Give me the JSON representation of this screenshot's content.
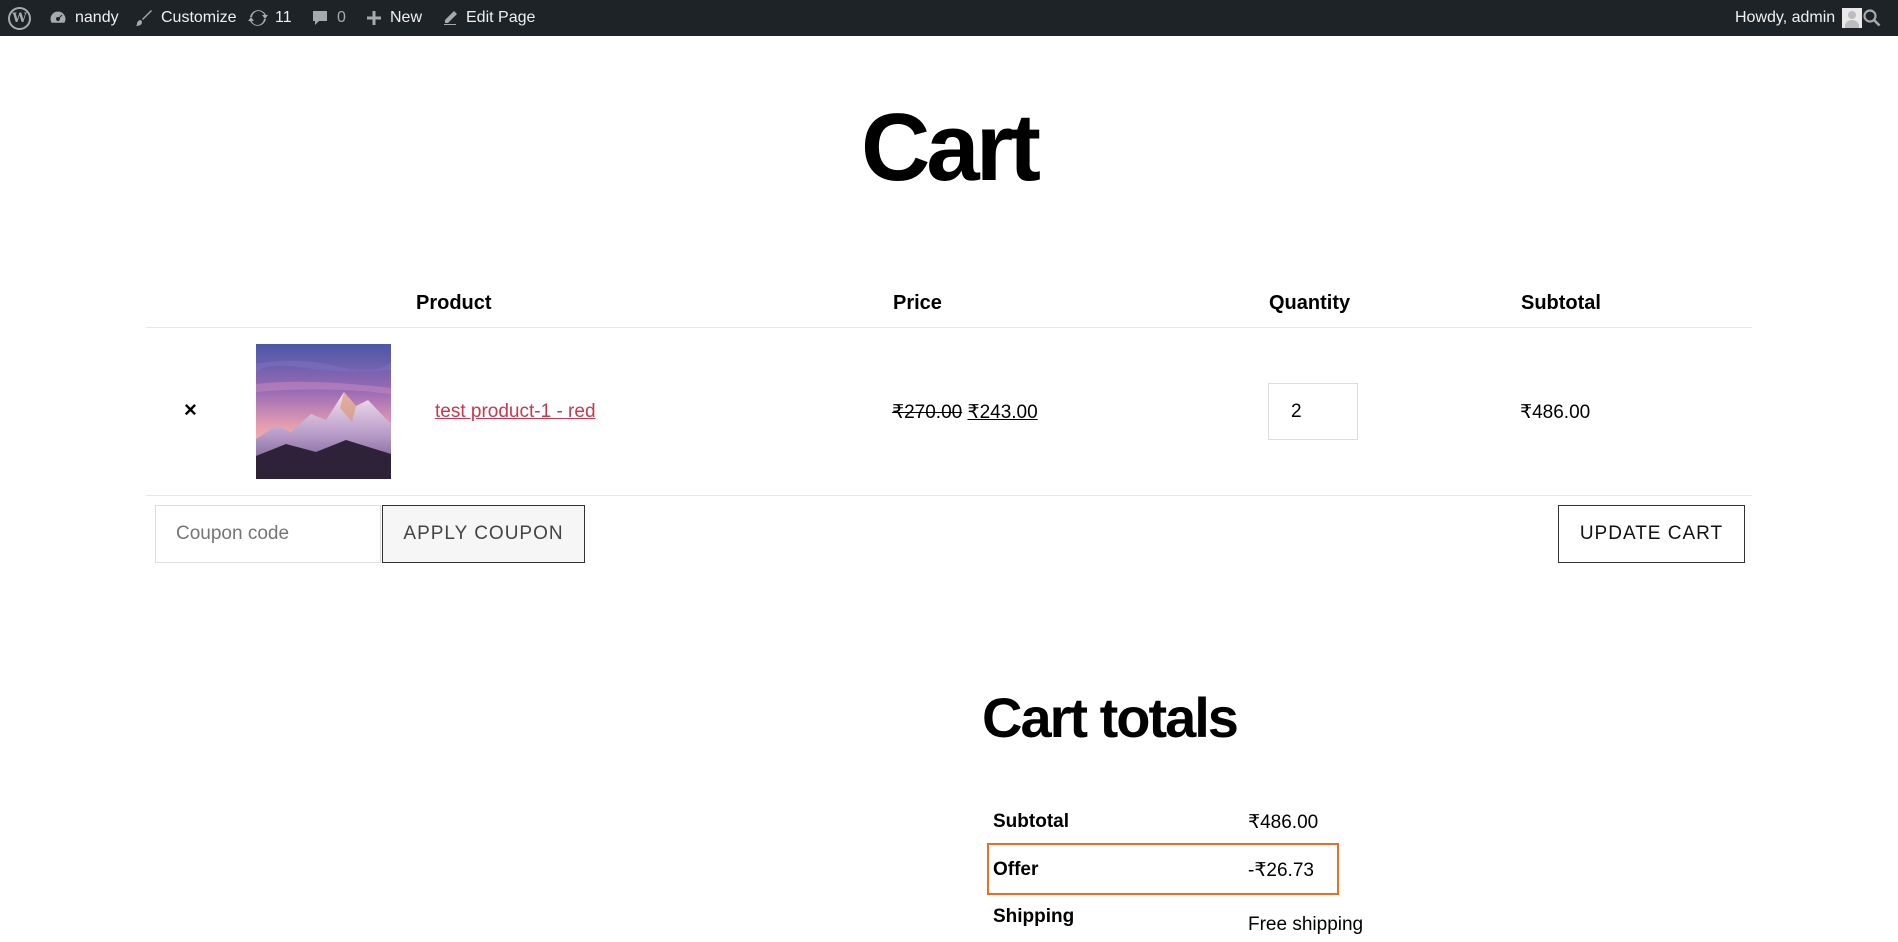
{
  "admin_bar": {
    "site_name": "nandy",
    "customize": "Customize",
    "updates_count": "11",
    "comments_count": "0",
    "new": "New",
    "edit_page": "Edit Page",
    "howdy": "Howdy, admin"
  },
  "page": {
    "title": "Cart"
  },
  "cart_table": {
    "headers": {
      "product": "Product",
      "price": "Price",
      "quantity": "Quantity",
      "subtotal": "Subtotal"
    },
    "items": [
      {
        "remove": "×",
        "name": "test product-1 - red",
        "price_regular": "₹270.00",
        "price_sale": "₹243.00",
        "quantity": "2",
        "subtotal": "₹486.00"
      }
    ]
  },
  "coupon": {
    "placeholder": "Coupon code",
    "apply_label": "APPLY COUPON"
  },
  "update_cart_label": "UPDATE CART",
  "cart_totals": {
    "title": "Cart totals",
    "rows": [
      {
        "label": "Subtotal",
        "value": "₹486.00"
      },
      {
        "label": "Offer",
        "value": "-₹26.73"
      },
      {
        "label": "Shipping",
        "value": "Free shipping"
      }
    ]
  },
  "colors": {
    "admin_bar_bg": "#1d2327",
    "link": "#c9374c",
    "highlight": "#f26b21"
  }
}
